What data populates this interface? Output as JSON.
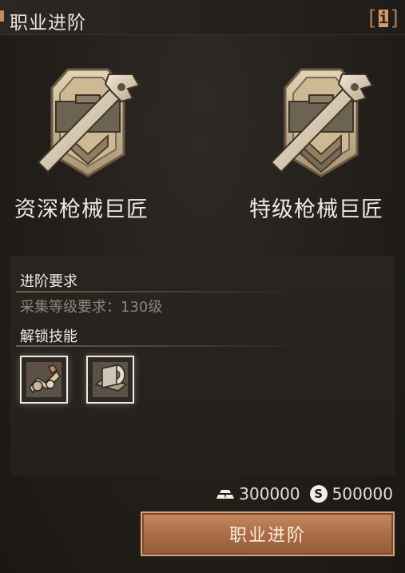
{
  "header": {
    "title": "职业进阶",
    "info_bracket_left": "[",
    "info_letter": "i",
    "info_bracket_right": "]"
  },
  "classes": {
    "current": {
      "name": "资深枪械巨匠",
      "icon": "gun-craftsman-icon"
    },
    "next": {
      "name": "特级枪械巨匠",
      "icon": "gun-craftsman-icon"
    }
  },
  "requirements": {
    "section_title": "进阶要求",
    "level_requirement": "采集等级要求：130级"
  },
  "skills": {
    "section_title": "解锁技能",
    "items": [
      {
        "icon": "mechanical-parts-skill-icon"
      },
      {
        "icon": "metal-roll-skill-icon"
      }
    ]
  },
  "cost": {
    "material_icon": "ingot-icon",
    "material_amount": "300000",
    "currency_icon": "silver-coin-icon",
    "currency_symbol": "S",
    "currency_amount": "500000"
  },
  "actions": {
    "advance_label": "职业进阶"
  },
  "colors": {
    "accent": "#c98a5a",
    "button": "#a86b45",
    "text_dim": "#8d857a"
  }
}
